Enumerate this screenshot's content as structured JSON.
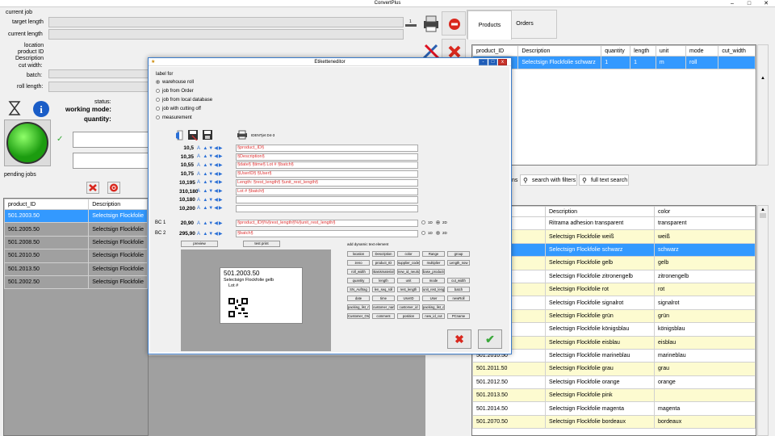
{
  "window": {
    "title": "ConvertPlus"
  },
  "left_panel": {
    "labels": {
      "current_job": "current job",
      "target_length": "target length",
      "current_length": "current  length",
      "location": "location",
      "product_id": "product ID",
      "description": "Description",
      "cut_width": "cut width:",
      "batch": "batch:",
      "roll_length": "roll length:",
      "status": "status:",
      "working_mode": "working mode:",
      "quantity": "quantity:",
      "pending_jobs": "pending jobs"
    },
    "counter": {
      "value": "1"
    },
    "pending_grid": {
      "columns": [
        "product_ID",
        "Description"
      ],
      "rows": [
        [
          "501.2003.50",
          "Selectsign Flockfolie"
        ],
        [
          "501.2005.50",
          "Selectsign Flockfolie"
        ],
        [
          "501.2008.50",
          "Selectsign Flockfolie"
        ],
        [
          "501.2010.50",
          "Selectsign Flockfolie"
        ],
        [
          "501.2013.50",
          "Selectsign Flockfolie"
        ],
        [
          "501.2002.50",
          "Selectsign Flockfolie"
        ]
      ],
      "selected_index": 0
    }
  },
  "right_panel": {
    "tabs": [
      "Products",
      "Orders"
    ],
    "products_grid": {
      "columns": [
        "product_ID",
        "Description",
        "quantity",
        "length",
        "unit",
        "mode",
        "cut_width"
      ],
      "rows": [
        [
          "",
          "Selectsign Flockfolie schwarz",
          "1",
          "1",
          "m",
          "roll",
          ""
        ]
      ]
    },
    "search": {
      "partial_tab": "ns",
      "filter_label": "search with filters",
      "fulltext_label": "full text search"
    },
    "catalog_grid": {
      "columns": [
        "",
        "Description",
        "color"
      ],
      "rows": [
        {
          "id": "",
          "desc": "Ritrama adhesion transparent",
          "color": "transparent",
          "style": "white"
        },
        {
          "id": "",
          "desc": "Selectsign Flockfolie weiß",
          "color": "weiß",
          "style": "yellow"
        },
        {
          "id": "",
          "desc": "Selectsign Flockfolie schwarz",
          "color": "schwarz",
          "style": "selected"
        },
        {
          "id": "",
          "desc": "Selectsign Flockfolie gelb",
          "color": "gelb",
          "style": "yellow"
        },
        {
          "id": "",
          "desc": "Selectsign Flockfolie zitronengelb",
          "color": "zitronengelb",
          "style": "white"
        },
        {
          "id": "",
          "desc": "Selectsign Flockfolie rot",
          "color": "rot",
          "style": "yellow"
        },
        {
          "id": "",
          "desc": "Selectsign Flockfolie signalrot",
          "color": "signalrot",
          "style": "white"
        },
        {
          "id": "",
          "desc": "Selectsign Flockfolie grün",
          "color": "grün",
          "style": "yellow"
        },
        {
          "id": "",
          "desc": "Selectsign Flockfolie königsblau",
          "color": "königsblau",
          "style": "white"
        },
        {
          "id": "",
          "desc": "Selectsign Flockfolie eisblau",
          "color": "eisblau",
          "style": "yellow"
        },
        {
          "id": "501.2010.50",
          "desc": "Selectsign Flockfolie marineblau",
          "color": "marineblau",
          "style": "white"
        },
        {
          "id": "501.2011.50",
          "desc": "Selectsign Flockfolie grau",
          "color": "grau",
          "style": "yellow"
        },
        {
          "id": "501.2012.50",
          "desc": "Selectsign Flockfolie orange",
          "color": "orange",
          "style": "white"
        },
        {
          "id": "501.2013.50",
          "desc": "Selectsign Flockfolie pink",
          "color": "",
          "style": "yellow"
        },
        {
          "id": "501.2014.50",
          "desc": "Selectsign Flockfolie magenta",
          "color": "magenta",
          "style": "white"
        },
        {
          "id": "501.2070.50",
          "desc": "Selectsign Flockfolie bordeaux",
          "color": "bordeaux",
          "style": "yellow"
        }
      ]
    }
  },
  "dialog": {
    "title": "Etiketteneditor",
    "label_for": "label for",
    "options": [
      "warehouse roll",
      "job from Order",
      "job from local database",
      "job with cutting off",
      "measurement"
    ],
    "selected_option": 0,
    "printer_label": "IDENTjet D4-3",
    "rows": [
      {
        "num": "10,5",
        "text": "§product_ID§"
      },
      {
        "num": "10,35",
        "text": "§Description§"
      },
      {
        "num": "10,55",
        "text": "§date§ §time§   Lot # §batch§"
      },
      {
        "num": "10,75",
        "text": "§UserID§ §User§"
      },
      {
        "num": "10,195",
        "text": "Length: §rest_length§ §unit_rest_length§"
      },
      {
        "num": "310,180",
        "text": "Lot # §batch§"
      },
      {
        "num": "10,180",
        "text": ""
      },
      {
        "num": "10,200",
        "text": ""
      }
    ],
    "barcodes": [
      {
        "label": "BC 1",
        "num": "20,90",
        "text": "§product_ID§%§rest_length§%§unit_rest_length§",
        "opt1": "1D",
        "opt2": "2D",
        "selected": "2D"
      },
      {
        "label": "BC 2",
        "num": "295,90",
        "text": "§batch§",
        "opt1": "1D",
        "opt2": "2D",
        "selected": "2D"
      }
    ],
    "preview_button": "preview",
    "test_print_button": "test print",
    "dynamic_title": "add dynamic text element",
    "dynamic_buttons": [
      "location",
      "Description",
      "color",
      "Range",
      "group",
      "zeno",
      "product_ID",
      "supplier_code",
      "multiplier",
      "Length_now",
      "roll_width",
      "Basismaterial",
      "new_id_neutral",
      "base_products",
      "quantity",
      "length",
      "unit",
      "mode",
      "cut_width",
      "SN_Auftrag",
      "len_seq_roll",
      "rest_length",
      "unit_rest_length",
      "batch",
      "date",
      "time",
      "UserID",
      "User",
      "newRoll",
      "packing_list_no",
      "customer_name",
      "customer_id",
      "packing_list_date",
      "Customer_Order",
      "comment",
      "position",
      "new_id_cut",
      "PCname"
    ],
    "preview_label": {
      "line1": "501.2003.50",
      "line2": "Selectsign Flockfolie gelb",
      "line3": "Lot #"
    }
  }
}
